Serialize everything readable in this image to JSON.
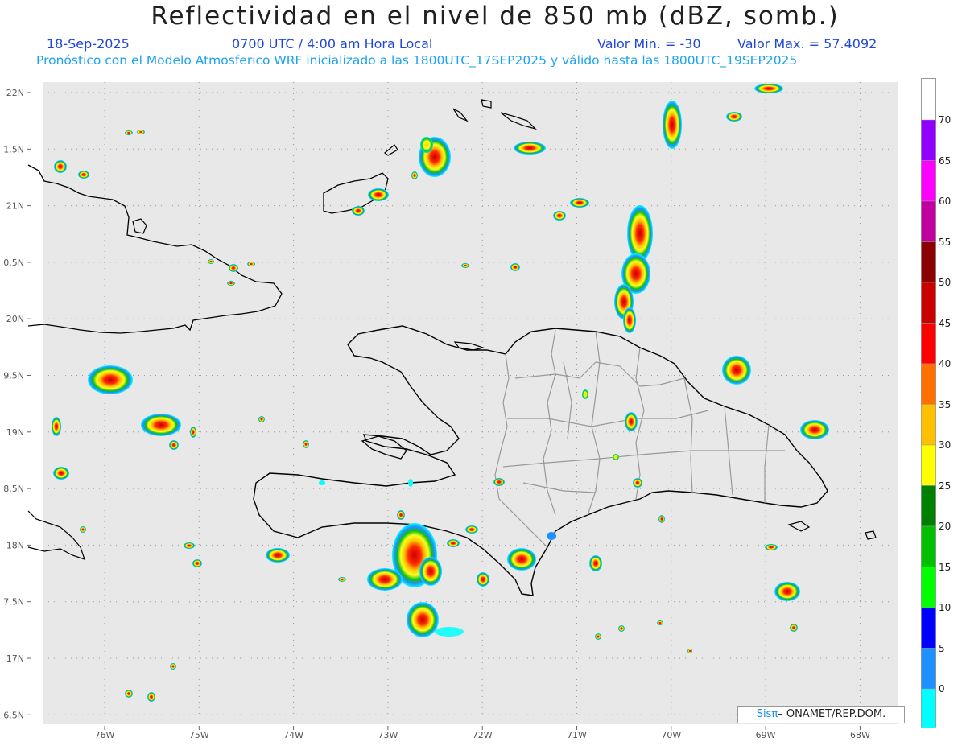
{
  "header": {
    "title": "Reflectividad en el nivel de 850 mb (dBZ, somb.)",
    "date": "18-Sep-2025",
    "time": "0700 UTC / 4:00 am Hora Local",
    "min_label": "Valor Min. = -30",
    "max_label": "Valor Max. = 57.4092",
    "forecast_line": "Pronóstico con el Modelo Atmosferico WRF inicializado a las 1800UTC_17SEP2025 y válido hasta las  1800UTC_19SEP2025"
  },
  "map": {
    "lat_labels": [
      "22N",
      "1.5N",
      "21N",
      "0.5N",
      "20N",
      "9.5N",
      "19N",
      "8.5N",
      "18N",
      "7.5N",
      "17N",
      "6.5N"
    ],
    "lon_labels": [
      "76W",
      "75W",
      "74W",
      "73W",
      "72W",
      "71W",
      "70W",
      "69W",
      "68W"
    ],
    "background_color": "#e8e8e8",
    "grid": "dotted"
  },
  "colorbar": {
    "labels": [
      "70",
      "65",
      "60",
      "55",
      "50",
      "45",
      "40",
      "35",
      "30",
      "25",
      "20",
      "15",
      "10",
      "5",
      "0"
    ],
    "colors": [
      "#9000ff",
      "#ff00ff",
      "#c000a0",
      "#8b0000",
      "#c80000",
      "#ff0000",
      "#ff7000",
      "#ffc000",
      "#ffff00",
      "#008000",
      "#00c000",
      "#00ff00",
      "#0000ff",
      "#1e90ff",
      "#00ffff"
    ]
  },
  "credit": {
    "sis": "Sis",
    "pi": "π",
    "rest": "– ONAMET/REP.DOM."
  }
}
